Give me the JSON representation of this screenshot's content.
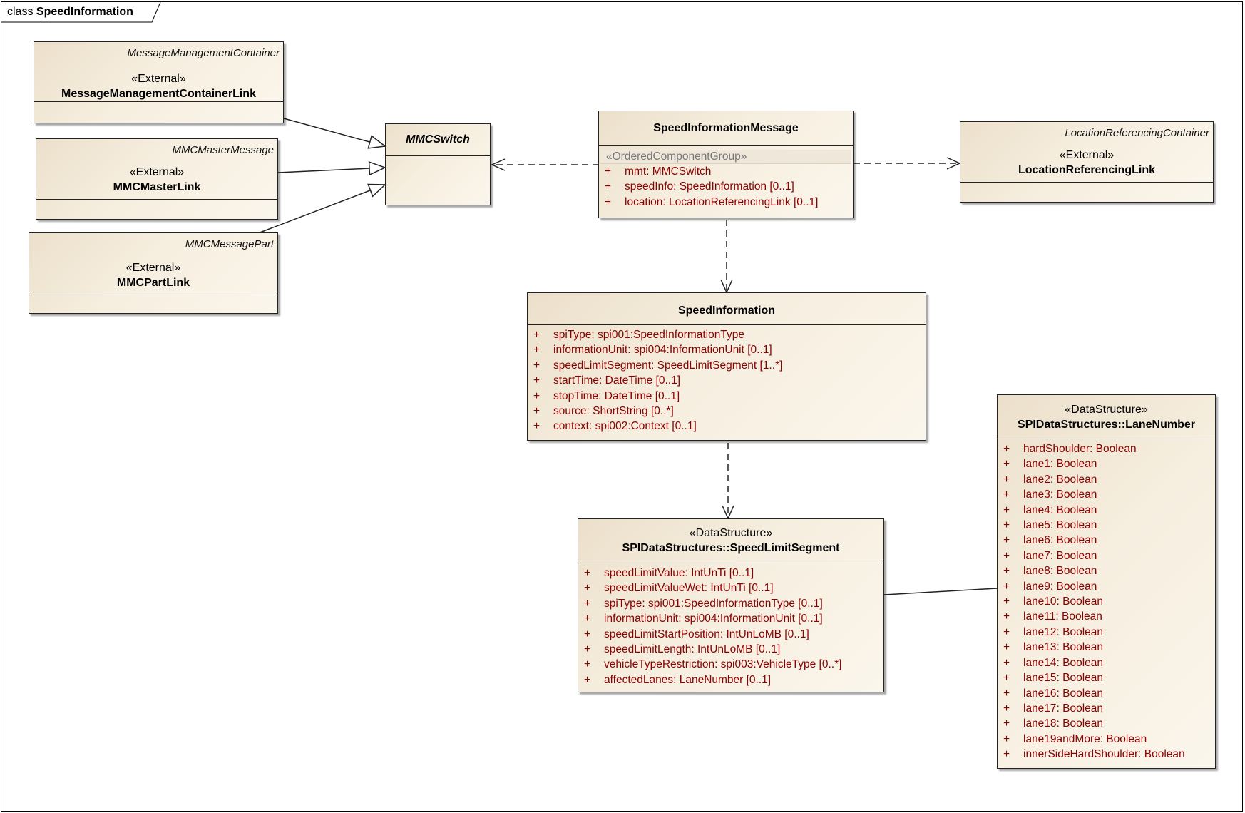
{
  "diagram": {
    "kind": "class",
    "name": "SpeedInformation"
  },
  "classes": {
    "mmc_link": {
      "package": "MessageManagementContainer",
      "stereotype": "«External»",
      "name": "MessageManagementContainerLink"
    },
    "master_link": {
      "package": "MMCMasterMessage",
      "stereotype": "«External»",
      "name": "MMCMasterLink"
    },
    "part_link": {
      "package": "MMCMessagePart",
      "stereotype": "«External»",
      "name": "MMCPartLink"
    },
    "mmc_switch": {
      "name": "MMCSwitch"
    },
    "speed_info_message": {
      "name": "SpeedInformationMessage",
      "group_label": "«OrderedComponentGroup»",
      "attributes": [
        {
          "vis": "+",
          "text": "mmt:  MMCSwitch"
        },
        {
          "vis": "+",
          "text": "speedInfo:  SpeedInformation [0..1]"
        },
        {
          "vis": "+",
          "text": "location:  LocationReferencingLink [0..1]"
        }
      ]
    },
    "location_link": {
      "package": "LocationReferencingContainer",
      "stereotype": "«External»",
      "name": "LocationReferencingLink"
    },
    "speed_information": {
      "name": "SpeedInformation",
      "attributes": [
        {
          "vis": "+",
          "text": "spiType:  spi001:SpeedInformationType"
        },
        {
          "vis": "+",
          "text": "informationUnit:  spi004:InformationUnit [0..1]"
        },
        {
          "vis": "+",
          "text": "speedLimitSegment:  SpeedLimitSegment [1..*]"
        },
        {
          "vis": "+",
          "text": "startTime:  DateTime [0..1]"
        },
        {
          "vis": "+",
          "text": "stopTime:  DateTime [0..1]"
        },
        {
          "vis": "+",
          "text": "source:  ShortString [0..*]"
        },
        {
          "vis": "+",
          "text": "context:  spi002:Context [0..1]"
        }
      ]
    },
    "speed_limit_segment": {
      "stereotype": "«DataStructure»",
      "name": "SPIDataStructures::SpeedLimitSegment",
      "attributes": [
        {
          "vis": "+",
          "text": "speedLimitValue:  IntUnTi [0..1]"
        },
        {
          "vis": "+",
          "text": "speedLimitValueWet:  IntUnTi [0..1]"
        },
        {
          "vis": "+",
          "text": "spiType:  spi001:SpeedInformationType [0..1]"
        },
        {
          "vis": "+",
          "text": "informationUnit:  spi004:InformationUnit [0..1]"
        },
        {
          "vis": "+",
          "text": "speedLimitStartPosition:  IntUnLoMB [0..1]"
        },
        {
          "vis": "+",
          "text": "speedLimitLength:  IntUnLoMB [0..1]"
        },
        {
          "vis": "+",
          "text": "vehicleTypeRestriction:  spi003:VehicleType [0..*]"
        },
        {
          "vis": "+",
          "text": "affectedLanes:  LaneNumber [0..1]"
        }
      ]
    },
    "lane_number": {
      "stereotype": "«DataStructure»",
      "name": "SPIDataStructures::LaneNumber",
      "attributes": [
        {
          "vis": "+",
          "text": "hardShoulder:  Boolean"
        },
        {
          "vis": "+",
          "text": "lane1:  Boolean"
        },
        {
          "vis": "+",
          "text": "lane2:  Boolean"
        },
        {
          "vis": "+",
          "text": "lane3:  Boolean"
        },
        {
          "vis": "+",
          "text": "lane4:  Boolean"
        },
        {
          "vis": "+",
          "text": "lane5:  Boolean"
        },
        {
          "vis": "+",
          "text": "lane6:  Boolean"
        },
        {
          "vis": "+",
          "text": "lane7:  Boolean"
        },
        {
          "vis": "+",
          "text": "lane8:  Boolean"
        },
        {
          "vis": "+",
          "text": "lane9:  Boolean"
        },
        {
          "vis": "+",
          "text": "lane10:  Boolean"
        },
        {
          "vis": "+",
          "text": "lane11:  Boolean"
        },
        {
          "vis": "+",
          "text": "lane12:  Boolean"
        },
        {
          "vis": "+",
          "text": "lane13:  Boolean"
        },
        {
          "vis": "+",
          "text": "lane14:  Boolean"
        },
        {
          "vis": "+",
          "text": "lane15:  Boolean"
        },
        {
          "vis": "+",
          "text": "lane16:  Boolean"
        },
        {
          "vis": "+",
          "text": "lane17:  Boolean"
        },
        {
          "vis": "+",
          "text": "lane18:  Boolean"
        },
        {
          "vis": "+",
          "text": "lane19andMore:  Boolean"
        },
        {
          "vis": "+",
          "text": "innerSideHardShoulder:  Boolean"
        }
      ]
    }
  },
  "relations": [
    {
      "type": "generalization",
      "from": "MessageManagementContainerLink",
      "to": "MMCSwitch"
    },
    {
      "type": "generalization",
      "from": "MMCMasterLink",
      "to": "MMCSwitch"
    },
    {
      "type": "generalization",
      "from": "MMCPartLink",
      "to": "MMCSwitch"
    },
    {
      "type": "dependency",
      "from": "SpeedInformationMessage",
      "to": "MMCSwitch"
    },
    {
      "type": "dependency",
      "from": "SpeedInformationMessage",
      "to": "LocationReferencingLink"
    },
    {
      "type": "dependency",
      "from": "SpeedInformationMessage",
      "to": "SpeedInformation"
    },
    {
      "type": "dependency",
      "from": "SpeedInformation",
      "to": "SPIDataStructures::SpeedLimitSegment"
    },
    {
      "type": "association",
      "from": "SPIDataStructures::SpeedLimitSegment",
      "to": "SPIDataStructures::LaneNumber"
    }
  ],
  "colors": {
    "attribute_text": "#8b0000",
    "class_fill": "#f4ecdc",
    "border": "#222222",
    "group_label": "#777777"
  }
}
